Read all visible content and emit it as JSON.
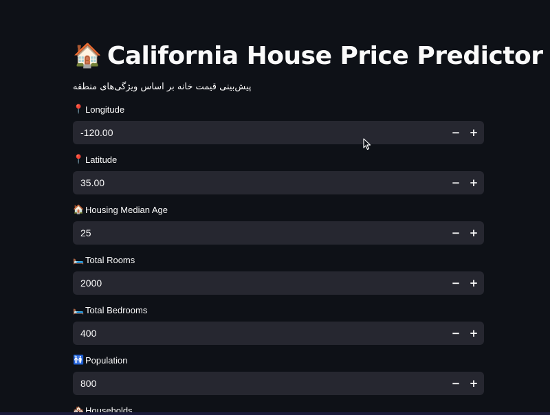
{
  "header": {
    "title_icon": "🏠",
    "title": "California House Price Predictor",
    "subtitle": "پیش‌بینی قیمت خانه بر اساس ویژگی‌های منطقه"
  },
  "fields": [
    {
      "icon": "📍",
      "icon_name": "pin-icon",
      "label": "Longitude",
      "value": "-120.00"
    },
    {
      "icon": "📍",
      "icon_name": "pin-icon",
      "label": "Latitude",
      "value": "35.00"
    },
    {
      "icon": "🏠",
      "icon_name": "house-icon",
      "label": "Housing Median Age",
      "value": "25"
    },
    {
      "icon": "🛏️",
      "icon_name": "bed-icon",
      "label": "Total Rooms",
      "value": "2000"
    },
    {
      "icon": "🛏️",
      "icon_name": "bed-icon",
      "label": "Total Bedrooms",
      "value": "400"
    },
    {
      "icon": "🚻",
      "icon_name": "people-icon",
      "label": "Population",
      "value": "800"
    },
    {
      "icon": "🏘️",
      "icon_name": "houses-icon",
      "label": "Households",
      "value": ""
    }
  ],
  "stepper": {
    "minus": "−",
    "plus": "+"
  },
  "colors": {
    "background": "#0e1117",
    "input_background": "#262730",
    "text": "#fafafa"
  }
}
